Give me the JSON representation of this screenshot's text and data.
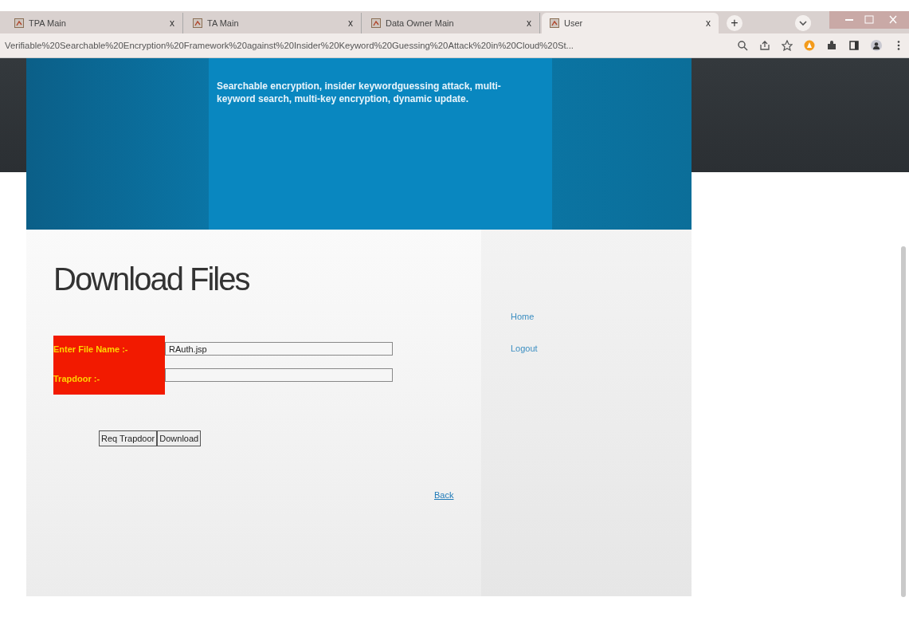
{
  "browser": {
    "tabs": [
      {
        "title": "TPA Main",
        "close": "x",
        "selected": false
      },
      {
        "title": "TA Main",
        "close": "x",
        "selected": false
      },
      {
        "title": "Data Owner Main",
        "close": "x",
        "selected": false
      },
      {
        "title": "User",
        "close": "x",
        "selected": true
      }
    ],
    "new_tab_glyph": "+",
    "url": "Verifiable%20Searchable%20Encryption%20Framework%20against%20Insider%20Keyword%20Guessing%20Attack%20in%20Cloud%20St..."
  },
  "header": {
    "keywords": "Searchable encryption, insider keywordguessing attack, multi-keyword search, multi-key encryption, dynamic update."
  },
  "main": {
    "title": "Download Files",
    "fields": [
      {
        "label": "Enter File Name :-",
        "value": "RAuth.jsp"
      },
      {
        "label": "Trapdoor :-"
      }
    ],
    "buttons": [
      "Req Trapdoor",
      "Download"
    ],
    "back_link": "Back"
  },
  "sidebar": {
    "links": [
      "Home",
      "Logout"
    ]
  }
}
